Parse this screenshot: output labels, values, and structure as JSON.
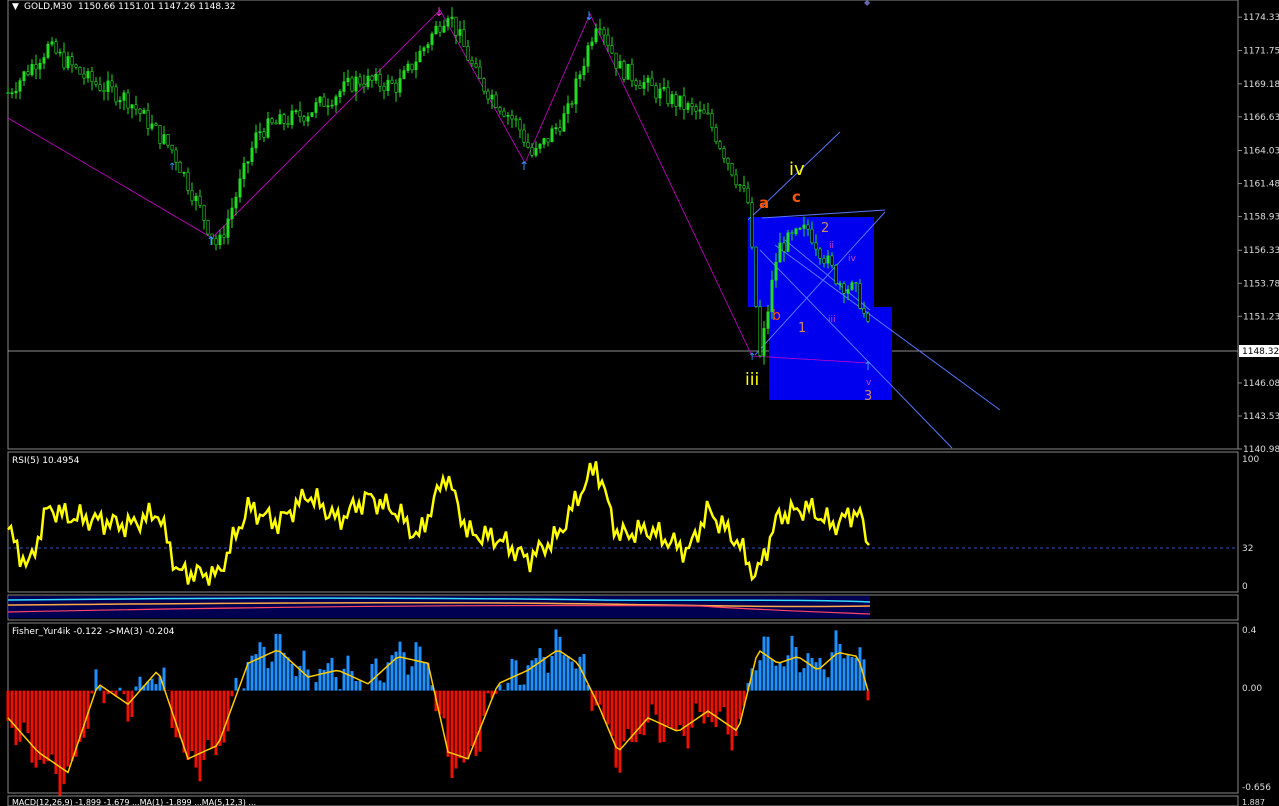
{
  "header": {
    "symbol": "GOLD,M30",
    "ohlc": "1150.66 1151.01 1147.26 1148.32"
  },
  "main_chart": {
    "price_ticks": [
      "1174.33",
      "1171.75",
      "1169.18",
      "1166.63",
      "1164.03",
      "1161.48",
      "1158.93",
      "1156.33",
      "1153.78",
      "1151.23",
      "1146.08",
      "1143.53",
      "1140.98"
    ],
    "current_price": "1148.32",
    "ylim": [
      1140.98,
      1175.5
    ],
    "wave_labels": {
      "iii": "iii",
      "iv": "iv",
      "a": "a",
      "b": "b",
      "c": "c",
      "n1": "1",
      "n2": "2",
      "n3": "3",
      "sub_ii": "ii",
      "sub_iii": "iii",
      "sub_iv": "iv",
      "sub_v": "v"
    },
    "colors": {
      "candles": "#22dd22",
      "zigzag": "#cc00cc",
      "box": "#0000ee",
      "channel": "#5577ff"
    }
  },
  "rsi_panel": {
    "label": "RSI(5) 10.4954",
    "ticks": [
      "100",
      "32",
      "0"
    ],
    "level": 32,
    "color": "#ffff00"
  },
  "fisher_panel": {
    "label": "Fisher_Yur4ik -0.122  ->MA(3) -0.204",
    "ticks": [
      "0.4",
      "0.00",
      "-0.656"
    ],
    "ylim": [
      -0.656,
      0.4
    ],
    "colors": {
      "positive": "#1e90ff",
      "negative": "#ee1100",
      "ma": "#ffcc00"
    }
  },
  "bottom_panel": {
    "label": "MACD(12,26,9) -1.899 -1.679 ...MA(1) -1.899 ...MA(5,12,3) ...",
    "tick": "1.887"
  },
  "chart_data": [
    {
      "type": "line",
      "title": "GOLD,M30",
      "description": "price (approximate swing points)",
      "x": [
        0,
        40,
        80,
        120,
        165,
        210,
        250,
        300,
        350,
        390,
        440,
        470,
        510,
        525,
        560,
        590,
        610,
        650,
        700,
        740,
        752,
        770,
        800,
        830,
        850,
        870
      ],
      "y": [
        1168.5,
        1172.0,
        1169.5,
        1168.0,
        1164.0,
        1156.5,
        1165.5,
        1167.0,
        1169.5,
        1169.0,
        1174.8,
        1169.5,
        1166.0,
        1163.5,
        1167.0,
        1174.5,
        1170.5,
        1168.5,
        1166.5,
        1160.0,
        1148.0,
        1156.5,
        1158.0,
        1154.0,
        1153.0,
        1147.5
      ],
      "ylim": [
        1140.98,
        1175.5
      ]
    },
    {
      "type": "line",
      "title": "RSI(5) 10.4954",
      "x": [
        0,
        20,
        40,
        60,
        90,
        120,
        150,
        170,
        210,
        240,
        270,
        300,
        330,
        360,
        390,
        410,
        438,
        460,
        490,
        520,
        550,
        570,
        588,
        610,
        640,
        680,
        700,
        730,
        748,
        770,
        800,
        825,
        850,
        870
      ],
      "values": [
        45,
        15,
        62,
        55,
        52,
        48,
        58,
        12,
        10,
        62,
        50,
        72,
        52,
        70,
        58,
        38,
        88,
        42,
        38,
        22,
        40,
        70,
        95,
        40,
        45,
        28,
        60,
        35,
        8,
        55,
        62,
        48,
        60,
        10
      ],
      "ylim": [
        0,
        100
      ]
    },
    {
      "type": "bar",
      "title": "Fisher_Yur4ik -0.122  ->MA(3) -0.204",
      "x": [
        0,
        30,
        60,
        90,
        120,
        150,
        180,
        210,
        240,
        270,
        300,
        330,
        360,
        390,
        420,
        440,
        460,
        490,
        520,
        550,
        570,
        590,
        610,
        640,
        670,
        700,
        730,
        750,
        770,
        790,
        810,
        830,
        850,
        870
      ],
      "values": [
        -0.2,
        -0.45,
        -0.6,
        0.05,
        -0.1,
        0.15,
        -0.5,
        -0.4,
        0.2,
        0.3,
        0.1,
        0.15,
        0.05,
        0.25,
        0.2,
        -0.45,
        -0.5,
        0.05,
        0.15,
        0.3,
        0.2,
        -0.1,
        -0.45,
        -0.2,
        -0.3,
        -0.15,
        -0.3,
        0.3,
        0.2,
        0.25,
        0.15,
        0.28,
        0.25,
        -0.25
      ],
      "ylim": [
        -0.656,
        0.4
      ]
    }
  ]
}
